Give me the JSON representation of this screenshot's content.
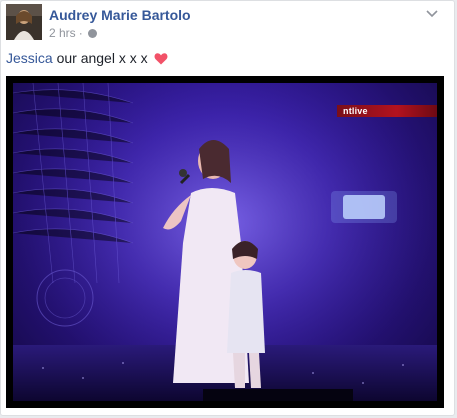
{
  "post": {
    "author": "Audrey Marie Bartolo",
    "timestamp": "2 hrs",
    "separator": "·",
    "audience_icon": "globe-icon",
    "menu_icon": "chevron-down-icon",
    "caption_tag": "Jessica",
    "caption_text": " our angel x x x",
    "caption_emoji": "heart-icon"
  },
  "media": {
    "broadcast_badge": "ntlive"
  },
  "colors": {
    "link": "#365899",
    "meta": "#90949c",
    "text": "#1d2129",
    "heart": "#f25268",
    "stage": "#3a1fb0"
  }
}
